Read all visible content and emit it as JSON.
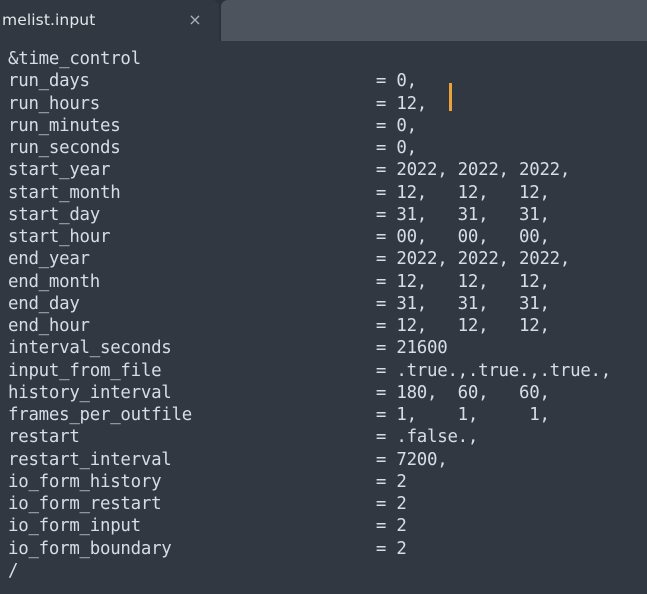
{
  "window": {
    "background_color": "#313842",
    "tabbar_color": "#4d545e"
  },
  "tabbar": {
    "active_tab": {
      "label": "melist.input",
      "close_icon": "×",
      "full_name": "namelist.input"
    }
  },
  "editor": {
    "language": "fortran-namelist",
    "text_color": "#d7dde6",
    "caret_color": "#e8a33d",
    "caret": {
      "line_index": 2,
      "after_text": "12,"
    },
    "lines": [
      "&time_control",
      "run_days                            = 0,",
      "run_hours                           = 12,",
      "run_minutes                         = 0,",
      "run_seconds                         = 0,",
      "start_year                          = 2022, 2022, 2022,",
      "start_month                         = 12,   12,   12,",
      "start_day                           = 31,   31,   31,",
      "start_hour                          = 00,   00,   00,",
      "end_year                            = 2022, 2022, 2022,",
      "end_month                           = 12,   12,   12,",
      "end_day                             = 31,   31,   31,",
      "end_hour                            = 12,   12,   12,",
      "interval_seconds                    = 21600",
      "input_from_file                     = .true.,.true.,.true.,",
      "history_interval                    = 180,  60,   60,",
      "frames_per_outfile                  = 1,    1,     1,",
      "restart                             = .false.,",
      "restart_interval                    = 7200,",
      "io_form_history                     = 2",
      "io_form_restart                     = 2",
      "io_form_input                       = 2",
      "io_form_boundary                    = 2",
      "/"
    ]
  }
}
